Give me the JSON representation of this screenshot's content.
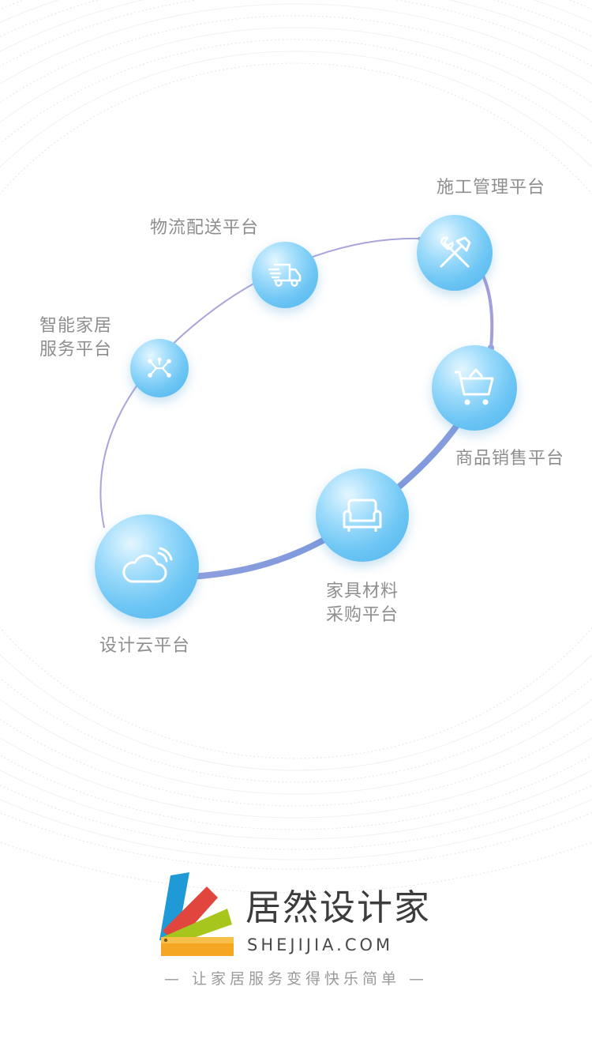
{
  "platforms": [
    {
      "id": "design-cloud",
      "label_lines": [
        "设计云平台"
      ],
      "icon": "cloud-icon"
    },
    {
      "id": "furniture-materials",
      "label_lines": [
        "家具材料",
        "采购平台"
      ],
      "icon": "sofa-icon"
    },
    {
      "id": "product-sales",
      "label_lines": [
        "商品销售平台"
      ],
      "icon": "shopping-cart-icon"
    },
    {
      "id": "construction-management",
      "label_lines": [
        "施工管理平台"
      ],
      "icon": "tools-icon"
    },
    {
      "id": "logistics",
      "label_lines": [
        "物流配送平台"
      ],
      "icon": "delivery-truck-icon"
    },
    {
      "id": "smart-home",
      "label_lines": [
        "智能家居",
        "服务平台"
      ],
      "icon": "network-icon"
    }
  ],
  "brand": {
    "name": "居然设计家",
    "domain": "SHEJIJIA.COM",
    "slogan": "— 让家居服务变得快乐简单 —",
    "logo_colors": [
      "#1f9ad6",
      "#e0463d",
      "#a7c61d",
      "#f5a623"
    ]
  },
  "colors": {
    "orbit_start": "#b9b6e6",
    "orbit_end": "#5b8fd8",
    "label": "#8e8e8e",
    "node": "#6ec6f4"
  }
}
